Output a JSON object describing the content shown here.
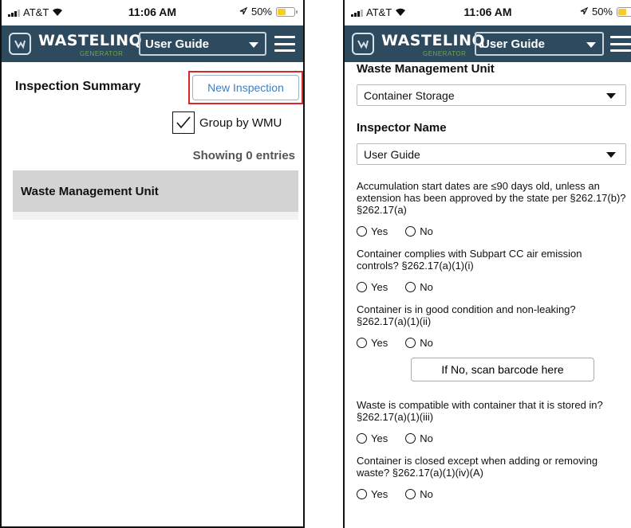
{
  "status_bar": {
    "carrier": "AT&T",
    "time": "11:06 AM",
    "battery": "50%",
    "battery_level": 0.5
  },
  "header": {
    "brand": "WASTELINQ",
    "brand_sub": "GENERATOR",
    "user_selected": "User Guide"
  },
  "left": {
    "title": "Inspection Summary",
    "new_button_label": "New Inspection",
    "group_label": "Group by WMU",
    "group_checked": true,
    "entries_text": "Showing 0 entries",
    "table_header": "Waste Management Unit"
  },
  "right": {
    "wmu_label": "Waste Management Unit",
    "wmu_value": "Container Storage",
    "inspector_label": "Inspector Name",
    "inspector_value": "User Guide",
    "yes_label": "Yes",
    "no_label": "No",
    "scan_button_label": "If No, scan barcode here",
    "questions": [
      "Accumulation start dates are ≤90 days old, unless an extension has been approved by the state per §262.17(b)? §262.17(a)",
      "Container complies with Subpart CC air emission controls? §262.17(a)(1)(i)",
      "Container is in good condition and non-leaking? §262.17(a)(1)(ii)",
      "Waste is compatible with container that it is stored in? §262.17(a)(1)(iii)",
      "Container is closed except when adding or removing waste? §262.17(a)(1)(iv)(A)"
    ]
  },
  "colors": {
    "header_bg": "#2e4a5e",
    "accent_blue": "#3d7fc1",
    "highlight_red": "#d9272e",
    "brand_green": "#6fa84a"
  }
}
